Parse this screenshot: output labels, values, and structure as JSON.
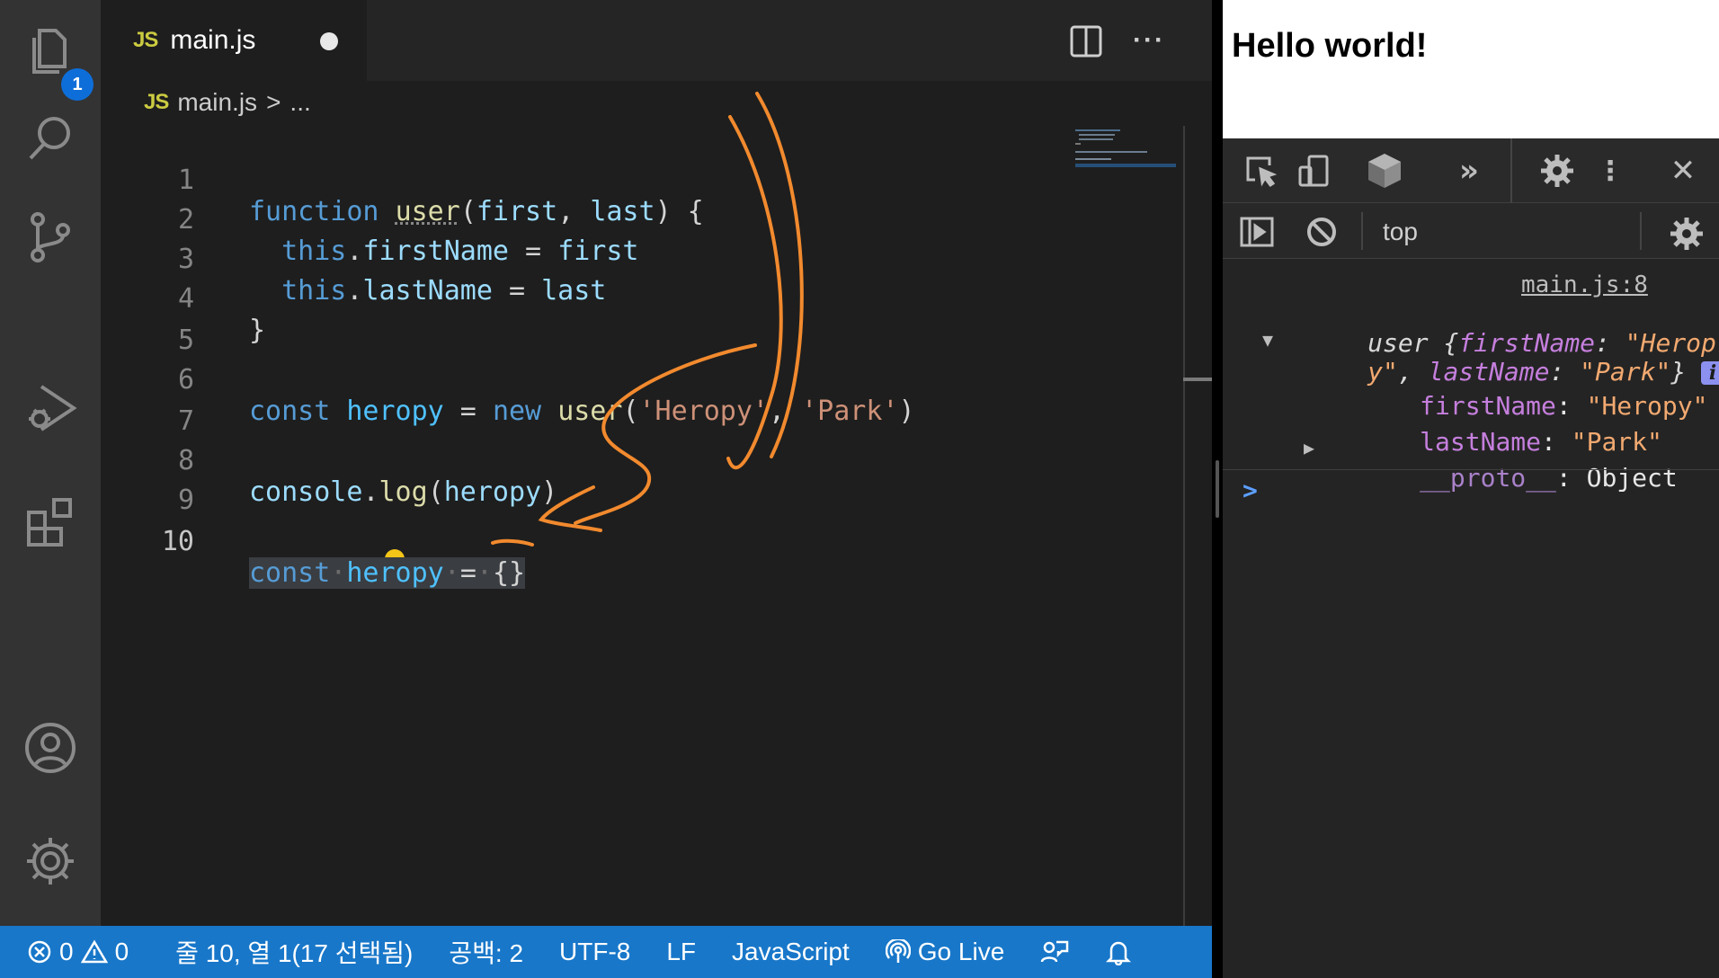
{
  "activity_bar": {
    "explorer_badge": "1",
    "items": [
      "files-icon",
      "search-icon",
      "source-control-icon",
      "run-debug-icon",
      "extensions-icon",
      "account-icon",
      "settings-gear-icon"
    ]
  },
  "tab": {
    "icon_text": "JS",
    "file_name": "main.js"
  },
  "breadcrumb": {
    "icon_text": "JS",
    "file": "main.js",
    "separator": ">",
    "rest": "..."
  },
  "editor": {
    "line_numbers": [
      "1",
      "2",
      "3",
      "4",
      "5",
      "6",
      "7",
      "8",
      "9",
      "10"
    ],
    "active_line": "10"
  },
  "devtools": {
    "page_heading": "Hello world!",
    "context": "top",
    "source_link": "main.js:8",
    "log_summary_prefix": "user {",
    "log_summary_key1": "firstName",
    "log_summary_val1a": "\"Herop",
    "log_summary_val1b": "y\"",
    "log_summary_key2": "lastName",
    "log_summary_val2": "\"Park\"",
    "log_summary_suffix": "}",
    "info_badge": "i",
    "prop1_key": "firstName",
    "prop1_val": "\"Heropy\"",
    "prop2_key": "lastName",
    "prop2_val": "\"Park\"",
    "proto_key": "__proto__",
    "proto_val": "Object",
    "prompt": ">"
  },
  "status_bar": {
    "errors": "0",
    "warnings": "0",
    "position": "줄 10, 열 1(17 선택됨)",
    "spaces": "공백: 2",
    "encoding": "UTF-8",
    "eol": "LF",
    "language": "JavaScript",
    "go_live": "Go Live"
  },
  "colors": {
    "status_bar": "#1877c9",
    "annotation": "#f28a2e",
    "badge": "#0e6ed9"
  }
}
